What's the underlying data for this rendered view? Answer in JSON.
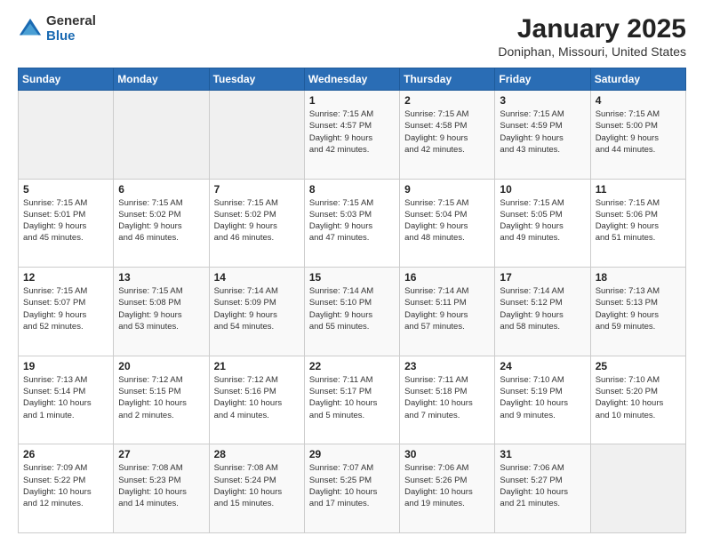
{
  "header": {
    "logo": {
      "general": "General",
      "blue": "Blue"
    },
    "title": "January 2025",
    "subtitle": "Doniphan, Missouri, United States"
  },
  "weekdays": [
    "Sunday",
    "Monday",
    "Tuesday",
    "Wednesday",
    "Thursday",
    "Friday",
    "Saturday"
  ],
  "weeks": [
    [
      {
        "day": "",
        "info": ""
      },
      {
        "day": "",
        "info": ""
      },
      {
        "day": "",
        "info": ""
      },
      {
        "day": "1",
        "info": "Sunrise: 7:15 AM\nSunset: 4:57 PM\nDaylight: 9 hours\nand 42 minutes."
      },
      {
        "day": "2",
        "info": "Sunrise: 7:15 AM\nSunset: 4:58 PM\nDaylight: 9 hours\nand 42 minutes."
      },
      {
        "day": "3",
        "info": "Sunrise: 7:15 AM\nSunset: 4:59 PM\nDaylight: 9 hours\nand 43 minutes."
      },
      {
        "day": "4",
        "info": "Sunrise: 7:15 AM\nSunset: 5:00 PM\nDaylight: 9 hours\nand 44 minutes."
      }
    ],
    [
      {
        "day": "5",
        "info": "Sunrise: 7:15 AM\nSunset: 5:01 PM\nDaylight: 9 hours\nand 45 minutes."
      },
      {
        "day": "6",
        "info": "Sunrise: 7:15 AM\nSunset: 5:02 PM\nDaylight: 9 hours\nand 46 minutes."
      },
      {
        "day": "7",
        "info": "Sunrise: 7:15 AM\nSunset: 5:02 PM\nDaylight: 9 hours\nand 46 minutes."
      },
      {
        "day": "8",
        "info": "Sunrise: 7:15 AM\nSunset: 5:03 PM\nDaylight: 9 hours\nand 47 minutes."
      },
      {
        "day": "9",
        "info": "Sunrise: 7:15 AM\nSunset: 5:04 PM\nDaylight: 9 hours\nand 48 minutes."
      },
      {
        "day": "10",
        "info": "Sunrise: 7:15 AM\nSunset: 5:05 PM\nDaylight: 9 hours\nand 49 minutes."
      },
      {
        "day": "11",
        "info": "Sunrise: 7:15 AM\nSunset: 5:06 PM\nDaylight: 9 hours\nand 51 minutes."
      }
    ],
    [
      {
        "day": "12",
        "info": "Sunrise: 7:15 AM\nSunset: 5:07 PM\nDaylight: 9 hours\nand 52 minutes."
      },
      {
        "day": "13",
        "info": "Sunrise: 7:15 AM\nSunset: 5:08 PM\nDaylight: 9 hours\nand 53 minutes."
      },
      {
        "day": "14",
        "info": "Sunrise: 7:14 AM\nSunset: 5:09 PM\nDaylight: 9 hours\nand 54 minutes."
      },
      {
        "day": "15",
        "info": "Sunrise: 7:14 AM\nSunset: 5:10 PM\nDaylight: 9 hours\nand 55 minutes."
      },
      {
        "day": "16",
        "info": "Sunrise: 7:14 AM\nSunset: 5:11 PM\nDaylight: 9 hours\nand 57 minutes."
      },
      {
        "day": "17",
        "info": "Sunrise: 7:14 AM\nSunset: 5:12 PM\nDaylight: 9 hours\nand 58 minutes."
      },
      {
        "day": "18",
        "info": "Sunrise: 7:13 AM\nSunset: 5:13 PM\nDaylight: 9 hours\nand 59 minutes."
      }
    ],
    [
      {
        "day": "19",
        "info": "Sunrise: 7:13 AM\nSunset: 5:14 PM\nDaylight: 10 hours\nand 1 minute."
      },
      {
        "day": "20",
        "info": "Sunrise: 7:12 AM\nSunset: 5:15 PM\nDaylight: 10 hours\nand 2 minutes."
      },
      {
        "day": "21",
        "info": "Sunrise: 7:12 AM\nSunset: 5:16 PM\nDaylight: 10 hours\nand 4 minutes."
      },
      {
        "day": "22",
        "info": "Sunrise: 7:11 AM\nSunset: 5:17 PM\nDaylight: 10 hours\nand 5 minutes."
      },
      {
        "day": "23",
        "info": "Sunrise: 7:11 AM\nSunset: 5:18 PM\nDaylight: 10 hours\nand 7 minutes."
      },
      {
        "day": "24",
        "info": "Sunrise: 7:10 AM\nSunset: 5:19 PM\nDaylight: 10 hours\nand 9 minutes."
      },
      {
        "day": "25",
        "info": "Sunrise: 7:10 AM\nSunset: 5:20 PM\nDaylight: 10 hours\nand 10 minutes."
      }
    ],
    [
      {
        "day": "26",
        "info": "Sunrise: 7:09 AM\nSunset: 5:22 PM\nDaylight: 10 hours\nand 12 minutes."
      },
      {
        "day": "27",
        "info": "Sunrise: 7:08 AM\nSunset: 5:23 PM\nDaylight: 10 hours\nand 14 minutes."
      },
      {
        "day": "28",
        "info": "Sunrise: 7:08 AM\nSunset: 5:24 PM\nDaylight: 10 hours\nand 15 minutes."
      },
      {
        "day": "29",
        "info": "Sunrise: 7:07 AM\nSunset: 5:25 PM\nDaylight: 10 hours\nand 17 minutes."
      },
      {
        "day": "30",
        "info": "Sunrise: 7:06 AM\nSunset: 5:26 PM\nDaylight: 10 hours\nand 19 minutes."
      },
      {
        "day": "31",
        "info": "Sunrise: 7:06 AM\nSunset: 5:27 PM\nDaylight: 10 hours\nand 21 minutes."
      },
      {
        "day": "",
        "info": ""
      }
    ]
  ]
}
